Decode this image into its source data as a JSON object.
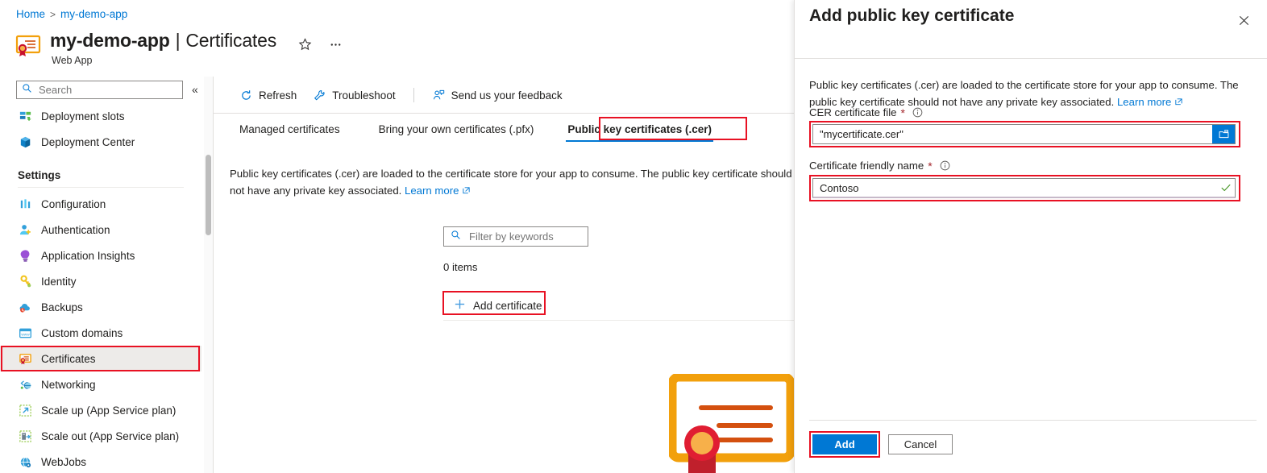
{
  "breadcrumb": {
    "home": "Home",
    "separator": ">",
    "current": "my-demo-app"
  },
  "header": {
    "title_main": "my-demo-app",
    "title_sep": "|",
    "title_section": "Certificates",
    "subtitle": "Web App",
    "favorite_icon": "star-icon",
    "more_icon": "ellipsis-icon",
    "resource_icon": "certificate-icon"
  },
  "sidebar": {
    "search_placeholder": "Search",
    "search_value": "",
    "search_icon": "search-icon",
    "collapse_icon": "double-chevron-left-icon",
    "items": [
      {
        "label": "Deployment slots",
        "icon": "deployment-slots-icon",
        "selected": false,
        "type": "item"
      },
      {
        "label": "Deployment Center",
        "icon": "deployment-center-icon",
        "selected": false,
        "type": "item"
      },
      {
        "label": "Settings",
        "type": "group"
      },
      {
        "label": "Configuration",
        "icon": "configuration-icon",
        "selected": false,
        "type": "item"
      },
      {
        "label": "Authentication",
        "icon": "authentication-icon",
        "selected": false,
        "type": "item"
      },
      {
        "label": "Application Insights",
        "icon": "application-insights-icon",
        "selected": false,
        "type": "item"
      },
      {
        "label": "Identity",
        "icon": "identity-key-icon",
        "selected": false,
        "type": "item"
      },
      {
        "label": "Backups",
        "icon": "backups-cloud-icon",
        "selected": false,
        "type": "item"
      },
      {
        "label": "Custom domains",
        "icon": "custom-domains-icon",
        "selected": false,
        "type": "item"
      },
      {
        "label": "Certificates",
        "icon": "certificate-icon",
        "selected": true,
        "type": "item"
      },
      {
        "label": "Networking",
        "icon": "networking-icon",
        "selected": false,
        "type": "item"
      },
      {
        "label": "Scale up (App Service plan)",
        "icon": "scale-up-icon",
        "selected": false,
        "type": "item"
      },
      {
        "label": "Scale out (App Service plan)",
        "icon": "scale-out-icon",
        "selected": false,
        "type": "item"
      },
      {
        "label": "WebJobs",
        "icon": "webjobs-icon",
        "selected": false,
        "type": "item"
      }
    ]
  },
  "toolbar": {
    "refresh_label": "Refresh",
    "refresh_icon": "refresh-icon",
    "troubleshoot_label": "Troubleshoot",
    "troubleshoot_icon": "wrench-icon",
    "feedback_label": "Send us your feedback",
    "feedback_icon": "person-feedback-icon"
  },
  "tabs": [
    {
      "label": "Managed certificates",
      "active": false
    },
    {
      "label": "Bring your own certificates (.pfx)",
      "active": false
    },
    {
      "label": "Public key certificates (.cer)",
      "active": true
    }
  ],
  "content": {
    "description": "Public key certificates (.cer) are loaded to the certificate store for your app to consume. The public key certificate should not have any private key associated.",
    "learn_more": "Learn more",
    "external_link_icon": "external-link-icon",
    "filter_placeholder": "Filter by keywords",
    "filter_value": "",
    "filter_icon": "search-icon",
    "items_count": "0 items",
    "add_certificate_label": "Add certificate",
    "add_icon": "plus-icon",
    "certificate_illustration": "certificate-illustration"
  },
  "panel": {
    "title": "Add public key certificate",
    "close_icon": "close-icon",
    "description": "Public key certificates (.cer) are loaded to the certificate store for your app to consume. The public key certificate should not have any private key associated.",
    "learn_more": "Learn more",
    "external_link_icon": "external-link-icon",
    "fields": [
      {
        "label": "CER certificate file",
        "required_marker": "*",
        "info_icon": "info-icon",
        "value": "\"mycertificate.cer\"",
        "placeholder": "",
        "trailing_icon": "folder-browse-icon",
        "highlighted": true
      },
      {
        "label": "Certificate friendly name",
        "required_marker": "*",
        "info_icon": "info-icon",
        "value": "Contoso",
        "placeholder": "",
        "trailing_icon": "valid-check-icon",
        "highlighted": true
      }
    ],
    "add_button": "Add",
    "cancel_button": "Cancel"
  },
  "colors": {
    "accent_blue": "#0078d4",
    "link_blue": "#0078d4",
    "highlight_red": "#e81123",
    "required_red": "#a4262c",
    "valid_green": "#4f9a2f",
    "selected_gray": "#edebe9",
    "cert_orange": "#f2a00c",
    "cert_dark_orange": "#d4500f",
    "cert_red": "#c8102e"
  }
}
